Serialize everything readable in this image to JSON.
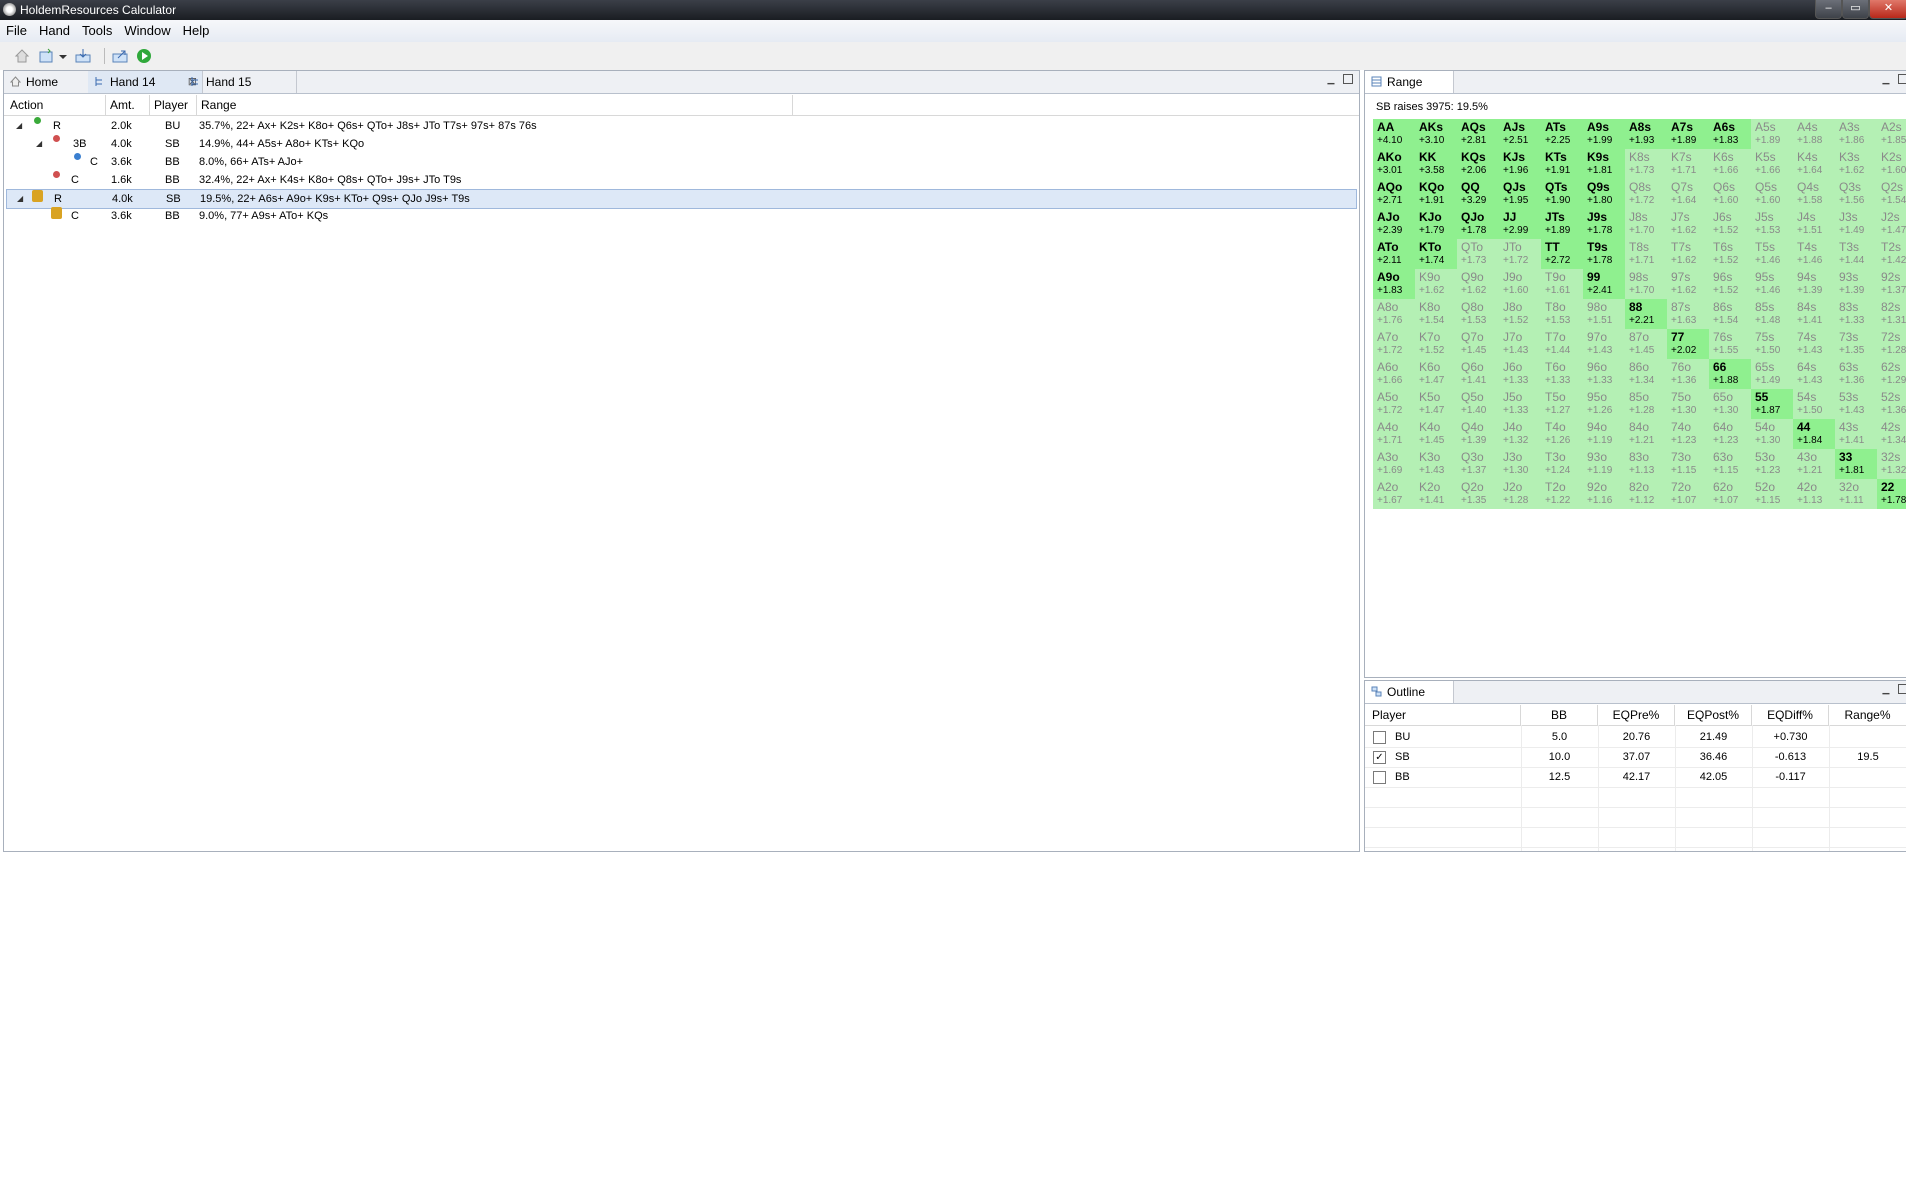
{
  "window": {
    "title": "HoldemResources Calculator",
    "buttons": [
      "–",
      "▭",
      "✕"
    ]
  },
  "menu": [
    "File",
    "Hand",
    "Tools",
    "Window",
    "Help"
  ],
  "tabs": [
    {
      "label": "Home"
    },
    {
      "label": "Hand 14",
      "close": "⊠"
    },
    {
      "label": "Hand 15"
    }
  ],
  "action_columns": [
    "Action",
    "Amt.",
    "Player",
    "Range"
  ],
  "action_rows": [
    {
      "action": "R",
      "amt": "2.0k",
      "player": "BU",
      "range": "35.7%, 22+ Ax+ K2s+ K8o+ Q6s+ QTo+ J8s+ JTo T7s+ 97s+ 87s 76s"
    },
    {
      "action": "3B",
      "amt": "4.0k",
      "player": "SB",
      "range": "14.9%, 44+ A5s+ A8o+ KTs+ KQo"
    },
    {
      "action": "C",
      "amt": "3.6k",
      "player": "BB",
      "range": "8.0%, 66+ ATs+ AJo+"
    },
    {
      "action": "C",
      "amt": "1.6k",
      "player": "BB",
      "range": "32.4%, 22+ Ax+ K4s+ K8o+ Q8s+ QTo+ J9s+ JTo T9s"
    },
    {
      "action": "R",
      "amt": "4.0k",
      "player": "SB",
      "range": "19.5%, 22+ A6s+ A9o+ K9s+ KTo+ Q9s+ QJo J9s+ T9s"
    },
    {
      "action": "C",
      "amt": "3.6k",
      "player": "BB",
      "range": "9.0%, 77+ A9s+ ATo+ KQs"
    }
  ],
  "range_panel": {
    "title": "Range",
    "caption": "SB raises 3975: 19.5%",
    "grid": [
      [
        [
          "AA",
          "+4.10",
          1
        ],
        [
          "AKs",
          "+3.10",
          1
        ],
        [
          "AQs",
          "+2.81",
          1
        ],
        [
          "AJs",
          "+2.51",
          1
        ],
        [
          "ATs",
          "+2.25",
          1
        ],
        [
          "A9s",
          "+1.99",
          1
        ],
        [
          "A8s",
          "+1.93",
          1
        ],
        [
          "A7s",
          "+1.89",
          1
        ],
        [
          "A6s",
          "+1.83",
          1
        ],
        [
          "A5s",
          "+1.89",
          0
        ],
        [
          "A4s",
          "+1.88",
          0
        ],
        [
          "A3s",
          "+1.86",
          0
        ],
        [
          "A2s",
          "+1.85",
          0
        ]
      ],
      [
        [
          "AKo",
          "+3.01",
          1
        ],
        [
          "KK",
          "+3.58",
          1
        ],
        [
          "KQs",
          "+2.06",
          1
        ],
        [
          "KJs",
          "+1.96",
          1
        ],
        [
          "KTs",
          "+1.91",
          1
        ],
        [
          "K9s",
          "+1.81",
          1
        ],
        [
          "K8s",
          "+1.73",
          0
        ],
        [
          "K7s",
          "+1.71",
          0
        ],
        [
          "K6s",
          "+1.66",
          0
        ],
        [
          "K5s",
          "+1.66",
          0
        ],
        [
          "K4s",
          "+1.64",
          0
        ],
        [
          "K3s",
          "+1.62",
          0
        ],
        [
          "K2s",
          "+1.60",
          0
        ]
      ],
      [
        [
          "AQo",
          "+2.71",
          1
        ],
        [
          "KQo",
          "+1.91",
          1
        ],
        [
          "QQ",
          "+3.29",
          1
        ],
        [
          "QJs",
          "+1.95",
          1
        ],
        [
          "QTs",
          "+1.90",
          1
        ],
        [
          "Q9s",
          "+1.80",
          1
        ],
        [
          "Q8s",
          "+1.72",
          0
        ],
        [
          "Q7s",
          "+1.64",
          0
        ],
        [
          "Q6s",
          "+1.60",
          0
        ],
        [
          "Q5s",
          "+1.60",
          0
        ],
        [
          "Q4s",
          "+1.58",
          0
        ],
        [
          "Q3s",
          "+1.56",
          0
        ],
        [
          "Q2s",
          "+1.54",
          0
        ]
      ],
      [
        [
          "AJo",
          "+2.39",
          1
        ],
        [
          "KJo",
          "+1.79",
          1
        ],
        [
          "QJo",
          "+1.78",
          1
        ],
        [
          "JJ",
          "+2.99",
          1
        ],
        [
          "JTs",
          "+1.89",
          1
        ],
        [
          "J9s",
          "+1.78",
          1
        ],
        [
          "J8s",
          "+1.70",
          0
        ],
        [
          "J7s",
          "+1.62",
          0
        ],
        [
          "J6s",
          "+1.52",
          0
        ],
        [
          "J5s",
          "+1.53",
          0
        ],
        [
          "J4s",
          "+1.51",
          0
        ],
        [
          "J3s",
          "+1.49",
          0
        ],
        [
          "J2s",
          "+1.47",
          0
        ]
      ],
      [
        [
          "ATo",
          "+2.11",
          1
        ],
        [
          "KTo",
          "+1.74",
          1
        ],
        [
          "QTo",
          "+1.73",
          0
        ],
        [
          "JTo",
          "+1.72",
          0
        ],
        [
          "TT",
          "+2.72",
          1
        ],
        [
          "T9s",
          "+1.78",
          1
        ],
        [
          "T8s",
          "+1.71",
          0
        ],
        [
          "T7s",
          "+1.62",
          0
        ],
        [
          "T6s",
          "+1.52",
          0
        ],
        [
          "T5s",
          "+1.46",
          0
        ],
        [
          "T4s",
          "+1.46",
          0
        ],
        [
          "T3s",
          "+1.44",
          0
        ],
        [
          "T2s",
          "+1.42",
          0
        ]
      ],
      [
        [
          "A9o",
          "+1.83",
          1
        ],
        [
          "K9o",
          "+1.62",
          0
        ],
        [
          "Q9o",
          "+1.62",
          0
        ],
        [
          "J9o",
          "+1.60",
          0
        ],
        [
          "T9o",
          "+1.61",
          0
        ],
        [
          "99",
          "+2.41",
          1
        ],
        [
          "98s",
          "+1.70",
          0
        ],
        [
          "97s",
          "+1.62",
          0
        ],
        [
          "96s",
          "+1.52",
          0
        ],
        [
          "95s",
          "+1.46",
          0
        ],
        [
          "94s",
          "+1.39",
          0
        ],
        [
          "93s",
          "+1.39",
          0
        ],
        [
          "92s",
          "+1.37",
          0
        ]
      ],
      [
        [
          "A8o",
          "+1.76",
          0
        ],
        [
          "K8o",
          "+1.54",
          0
        ],
        [
          "Q8o",
          "+1.53",
          0
        ],
        [
          "J8o",
          "+1.52",
          0
        ],
        [
          "T8o",
          "+1.53",
          0
        ],
        [
          "98o",
          "+1.51",
          0
        ],
        [
          "88",
          "+2.21",
          1
        ],
        [
          "87s",
          "+1.63",
          0
        ],
        [
          "86s",
          "+1.54",
          0
        ],
        [
          "85s",
          "+1.48",
          0
        ],
        [
          "84s",
          "+1.41",
          0
        ],
        [
          "83s",
          "+1.33",
          0
        ],
        [
          "82s",
          "+1.31",
          0
        ]
      ],
      [
        [
          "A7o",
          "+1.72",
          0
        ],
        [
          "K7o",
          "+1.52",
          0
        ],
        [
          "Q7o",
          "+1.45",
          0
        ],
        [
          "J7o",
          "+1.43",
          0
        ],
        [
          "T7o",
          "+1.44",
          0
        ],
        [
          "97o",
          "+1.43",
          0
        ],
        [
          "87o",
          "+1.45",
          0
        ],
        [
          "77",
          "+2.02",
          1
        ],
        [
          "76s",
          "+1.55",
          0
        ],
        [
          "75s",
          "+1.50",
          0
        ],
        [
          "74s",
          "+1.43",
          0
        ],
        [
          "73s",
          "+1.35",
          0
        ],
        [
          "72s",
          "+1.28",
          0
        ]
      ],
      [
        [
          "A6o",
          "+1.66",
          0
        ],
        [
          "K6o",
          "+1.47",
          0
        ],
        [
          "Q6o",
          "+1.41",
          0
        ],
        [
          "J6o",
          "+1.33",
          0
        ],
        [
          "T6o",
          "+1.33",
          0
        ],
        [
          "96o",
          "+1.33",
          0
        ],
        [
          "86o",
          "+1.34",
          0
        ],
        [
          "76o",
          "+1.36",
          0
        ],
        [
          "66",
          "+1.88",
          1
        ],
        [
          "65s",
          "+1.49",
          0
        ],
        [
          "64s",
          "+1.43",
          0
        ],
        [
          "63s",
          "+1.36",
          0
        ],
        [
          "62s",
          "+1.29",
          0
        ]
      ],
      [
        [
          "A5o",
          "+1.72",
          0
        ],
        [
          "K5o",
          "+1.47",
          0
        ],
        [
          "Q5o",
          "+1.40",
          0
        ],
        [
          "J5o",
          "+1.33",
          0
        ],
        [
          "T5o",
          "+1.27",
          0
        ],
        [
          "95o",
          "+1.26",
          0
        ],
        [
          "85o",
          "+1.28",
          0
        ],
        [
          "75o",
          "+1.30",
          0
        ],
        [
          "65o",
          "+1.30",
          0
        ],
        [
          "55",
          "+1.87",
          1
        ],
        [
          "54s",
          "+1.50",
          0
        ],
        [
          "53s",
          "+1.43",
          0
        ],
        [
          "52s",
          "+1.36",
          0
        ]
      ],
      [
        [
          "A4o",
          "+1.71",
          0
        ],
        [
          "K4o",
          "+1.45",
          0
        ],
        [
          "Q4o",
          "+1.39",
          0
        ],
        [
          "J4o",
          "+1.32",
          0
        ],
        [
          "T4o",
          "+1.26",
          0
        ],
        [
          "94o",
          "+1.19",
          0
        ],
        [
          "84o",
          "+1.21",
          0
        ],
        [
          "74o",
          "+1.23",
          0
        ],
        [
          "64o",
          "+1.23",
          0
        ],
        [
          "54o",
          "+1.30",
          0
        ],
        [
          "44",
          "+1.84",
          1
        ],
        [
          "43s",
          "+1.41",
          0
        ],
        [
          "42s",
          "+1.34",
          0
        ]
      ],
      [
        [
          "A3o",
          "+1.69",
          0
        ],
        [
          "K3o",
          "+1.43",
          0
        ],
        [
          "Q3o",
          "+1.37",
          0
        ],
        [
          "J3o",
          "+1.30",
          0
        ],
        [
          "T3o",
          "+1.24",
          0
        ],
        [
          "93o",
          "+1.19",
          0
        ],
        [
          "83o",
          "+1.13",
          0
        ],
        [
          "73o",
          "+1.15",
          0
        ],
        [
          "63o",
          "+1.15",
          0
        ],
        [
          "53o",
          "+1.23",
          0
        ],
        [
          "43o",
          "+1.21",
          0
        ],
        [
          "33",
          "+1.81",
          1
        ],
        [
          "32s",
          "+1.32",
          0
        ]
      ],
      [
        [
          "A2o",
          "+1.67",
          0
        ],
        [
          "K2o",
          "+1.41",
          0
        ],
        [
          "Q2o",
          "+1.35",
          0
        ],
        [
          "J2o",
          "+1.28",
          0
        ],
        [
          "T2o",
          "+1.22",
          0
        ],
        [
          "92o",
          "+1.16",
          0
        ],
        [
          "82o",
          "+1.12",
          0
        ],
        [
          "72o",
          "+1.07",
          0
        ],
        [
          "62o",
          "+1.07",
          0
        ],
        [
          "52o",
          "+1.15",
          0
        ],
        [
          "42o",
          "+1.13",
          0
        ],
        [
          "32o",
          "+1.11",
          0
        ],
        [
          "22",
          "+1.78",
          1
        ]
      ]
    ]
  },
  "outline": {
    "title": "Outline",
    "columns": [
      "Player",
      "BB",
      "EQPre%",
      "EQPost%",
      "EQDiff%",
      "Range%"
    ],
    "rows": [
      {
        "checked": false,
        "player": "BU",
        "bb": "5.0",
        "eqpre": "20.76",
        "eqpost": "21.49",
        "eqdiff": "+0.730",
        "range": ""
      },
      {
        "checked": true,
        "player": "SB",
        "bb": "10.0",
        "eqpre": "37.07",
        "eqpost": "36.46",
        "eqdiff": "-0.613",
        "range": "19.5"
      },
      {
        "checked": false,
        "player": "BB",
        "bb": "12.5",
        "eqpre": "42.17",
        "eqpost": "42.05",
        "eqdiff": "-0.117",
        "range": ""
      }
    ]
  },
  "colors": {
    "in_range": "#8ff08f",
    "out_range": "#b4f0b4",
    "raise_dot": "#3aaa3a",
    "call_dot": "#d05050",
    "check_dot": "#3a7fd0"
  }
}
